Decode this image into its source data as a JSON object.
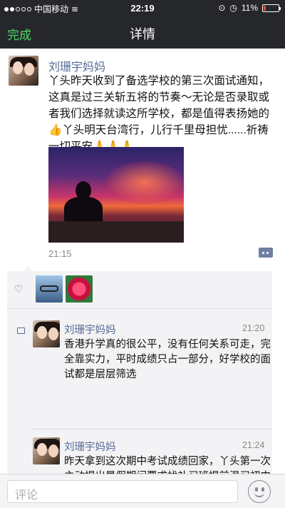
{
  "status_bar": {
    "carrier": "中国移动",
    "time": "22:19",
    "battery": "11%"
  },
  "nav": {
    "done_label": "完成",
    "title": "详情"
  },
  "post": {
    "author": "刘珊宇妈妈",
    "text": "丫头昨天收到了备选学校的第三次面试通知，这真是过三关斩五将的节奏～无论是否录取或者我们选择就读这所学校，都是值得表扬她的👍丫头明天台湾行，儿行千里母担忧......祈祷一切平安🙏🙏🙏",
    "time": "21:15"
  },
  "comments": [
    {
      "author": "刘珊宇妈妈",
      "time": "21:20",
      "text": "香港升学真的很公平，没有任何关系可走，完全靠实力，平时成绩只占一部分，好学校的面试都是层层筛选"
    },
    {
      "author": "刘珊宇妈妈",
      "time": "21:24",
      "text": "昨天拿到这次期中考试成绩回家，丫头第一次主动提出暑假期间要求找补习班提前温习初中数学，因为所有的教材全英文，她担心一直牛B的数学以后拿不到第一，突然觉得她是长大了"
    }
  ],
  "input": {
    "placeholder": "评论"
  },
  "icons": {
    "like": "heart-icon",
    "comment": "comment-icon",
    "more": "comment-more-icon",
    "emoji": "emoji-icon"
  }
}
